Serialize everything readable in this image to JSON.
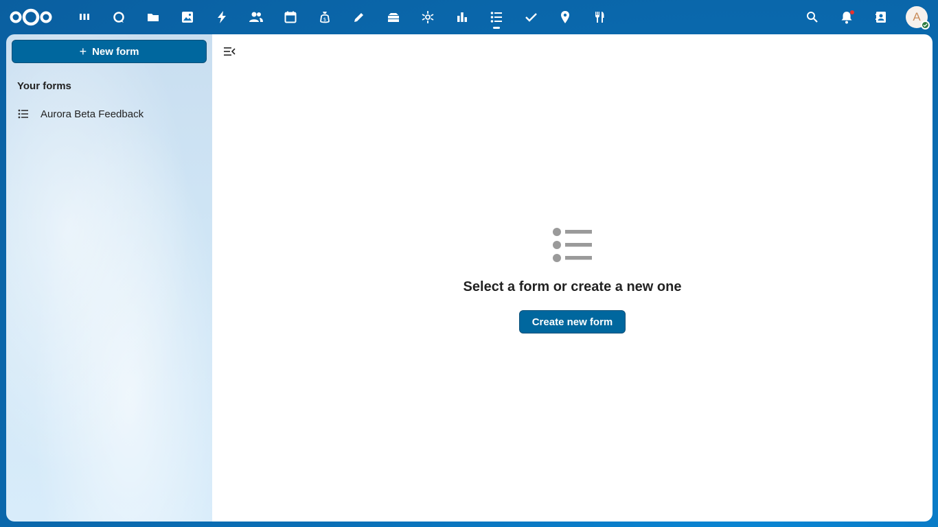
{
  "header": {
    "apps": [
      {
        "name": "dashboard-icon"
      },
      {
        "name": "talk-icon"
      },
      {
        "name": "files-icon"
      },
      {
        "name": "photos-icon"
      },
      {
        "name": "activity-icon"
      },
      {
        "name": "contacts-icon"
      },
      {
        "name": "calendar-icon"
      },
      {
        "name": "cospend-icon"
      },
      {
        "name": "notes-icon"
      },
      {
        "name": "deck-icon"
      },
      {
        "name": "astro-icon"
      },
      {
        "name": "analytics-icon"
      },
      {
        "name": "forms-icon",
        "active": true
      },
      {
        "name": "tasks-icon"
      },
      {
        "name": "maps-icon"
      },
      {
        "name": "cookbook-icon"
      }
    ],
    "avatar_initial": "A"
  },
  "sidebar": {
    "new_form_label": "New form",
    "section_title": "Your forms",
    "forms": [
      {
        "label": "Aurora Beta Feedback"
      }
    ]
  },
  "main": {
    "empty_title": "Select a form or create a new one",
    "create_button_label": "Create new form"
  },
  "colors": {
    "primary": "#00679e",
    "header_bg": "#0a6fb6",
    "status_online": "#2d7b41",
    "notification_dot": "#e9322d"
  }
}
